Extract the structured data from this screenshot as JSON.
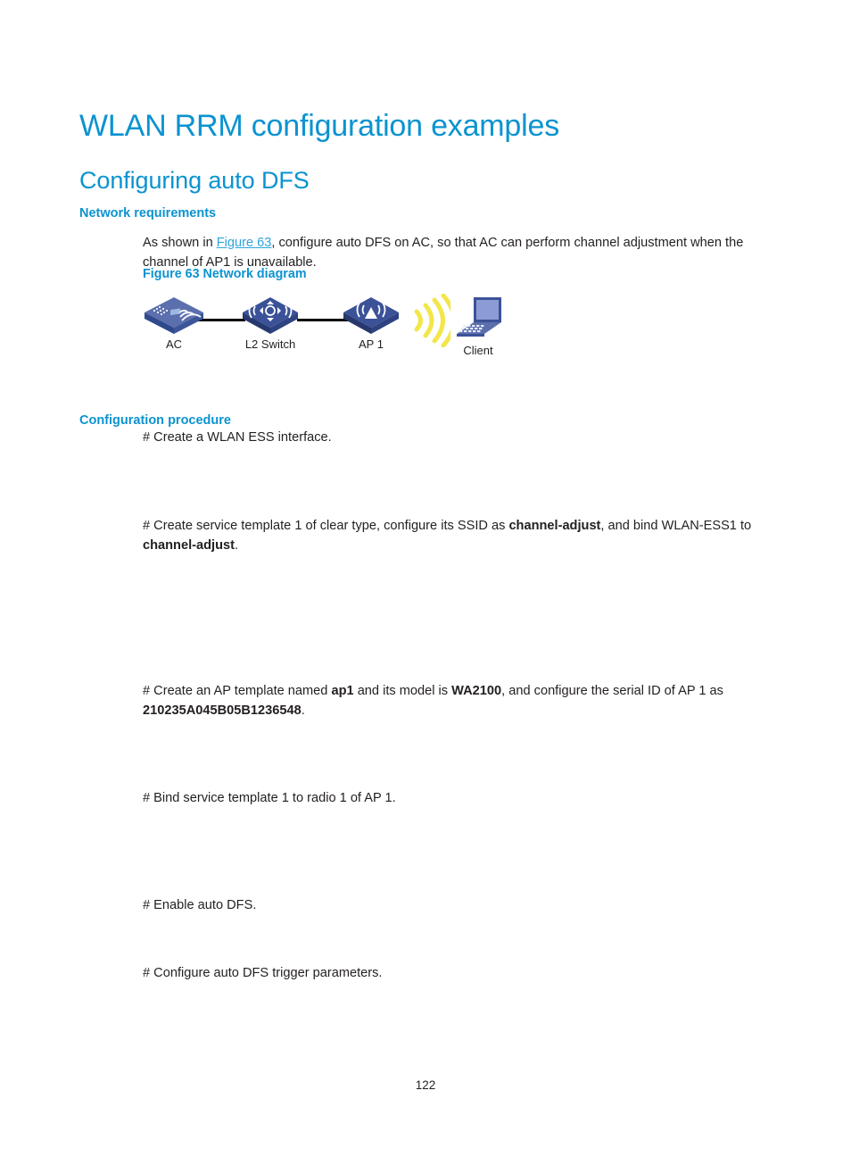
{
  "document": {
    "title": "WLAN RRM configuration examples",
    "subtitle": "Configuring auto DFS",
    "page_number": "122"
  },
  "sections": {
    "network_requirements": {
      "heading": "Network requirements",
      "intro_part1": "As shown in ",
      "intro_link": "Figure 63",
      "intro_part2": ", configure auto DFS on AC, so that AC can perform channel adjustment when the channel of AP1 is unavailable.",
      "figure_caption": "Figure 63 Network diagram"
    },
    "configuration_procedure": {
      "heading": "Configuration procedure",
      "steps": [
        "# Create a WLAN ESS interface.",
        "# Bind service template 1 to radio 1 of AP 1.",
        "# Enable auto DFS.",
        "# Configure auto DFS trigger parameters."
      ],
      "step_service_template": {
        "part1": "# Create service template 1 of clear type, configure its SSID as ",
        "bold1": "channel-adjust",
        "part2": ", and bind WLAN-ESS1 to ",
        "bold2": "channel-adjust",
        "part3": "."
      },
      "step_ap_template": {
        "part1": "# Create an AP template named ",
        "bold1": "ap1",
        "part2": " and its model is ",
        "bold2": "WA2100",
        "part3": ", and configure the serial ID of AP 1 as ",
        "bold3": "210235A045B05B1236548",
        "part4": "."
      }
    }
  },
  "diagram": {
    "nodes": [
      {
        "id": "ac",
        "label": "AC",
        "icon": "wireless-controller-icon"
      },
      {
        "id": "l2switch",
        "label": "L2 Switch",
        "icon": "switch-icon"
      },
      {
        "id": "ap1",
        "label": "AP 1",
        "icon": "access-point-icon"
      },
      {
        "id": "client",
        "label": "Client",
        "icon": "laptop-icon"
      }
    ],
    "wireless_signal": "wifi-waves-icon"
  },
  "colors": {
    "heading_blue": "#0b93d0",
    "link_blue": "#2ea3dc",
    "body_text": "#231f20",
    "device_blue": "#2f4a8c",
    "device_blue_light": "#5b6fae",
    "signal_yellow": "#f2e64b"
  }
}
